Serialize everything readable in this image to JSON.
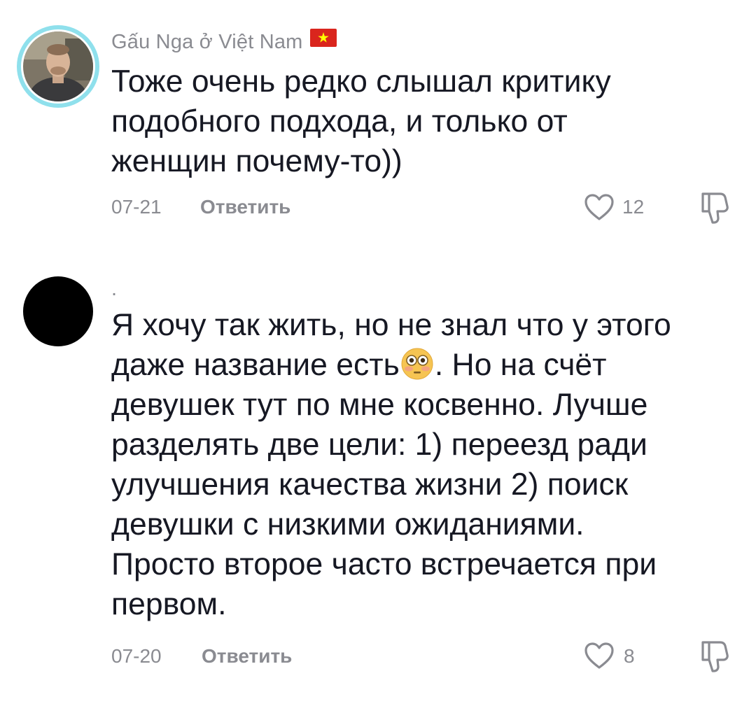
{
  "comments": [
    {
      "username": "Gấu Nga ở Việt Nam",
      "flag": "vietnam-flag",
      "text": "Тоже очень редко слышал критику\nподобного подхода, и только от\nженщин почему-то))",
      "date": "07-21",
      "reply_label": "Ответить",
      "likes": "12"
    },
    {
      "username": ".",
      "text_part1": "Я хочу так жить, но не знал что у этого\nдаже название есть",
      "emoji": "flushed-face-emoji",
      "text_part2": ". Но на счёт\nдевушек тут по мне косвенно. Лучше\nразделять две цели: 1) переезд ради\nулучшения качества жизни 2) поиск\nдевушки с низкими ожиданиями.\nПросто второе часто встречается при\nпервом.",
      "date": "07-20",
      "reply_label": "Ответить",
      "likes": "8"
    }
  ],
  "colors": {
    "text": "#161823",
    "muted": "#8a8b91",
    "avatar_ring": "#8fe0ec",
    "flag_red": "#da251d",
    "flag_yellow": "#ffff00"
  }
}
